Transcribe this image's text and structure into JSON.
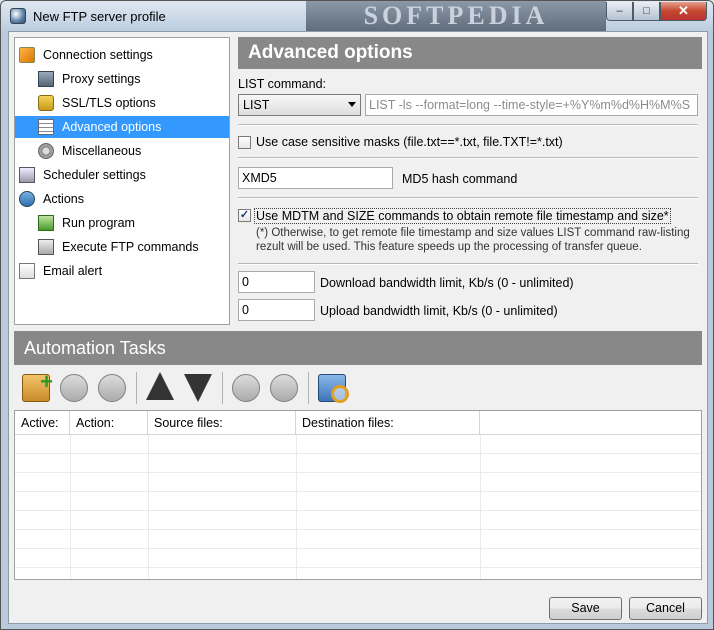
{
  "window": {
    "title": "New FTP server profile",
    "watermark": "SOFTPEDIA",
    "controls": {
      "minimize": "–",
      "maximize": "□",
      "close": "✕"
    }
  },
  "tree": {
    "items": [
      {
        "label": "Connection settings",
        "icon": "connection-icon",
        "level": 0
      },
      {
        "label": "Proxy settings",
        "icon": "proxy-icon",
        "level": 1
      },
      {
        "label": "SSL/TLS options",
        "icon": "lock-icon",
        "level": 1
      },
      {
        "label": "Advanced options",
        "icon": "advanced-icon",
        "level": 1,
        "selected": true
      },
      {
        "label": "Miscellaneous",
        "icon": "misc-icon",
        "level": 1
      },
      {
        "label": "Scheduler settings",
        "icon": "scheduler-icon",
        "level": 0
      },
      {
        "label": "Actions",
        "icon": "actions-icon",
        "level": 0
      },
      {
        "label": "Run program",
        "icon": "run-icon",
        "level": 1
      },
      {
        "label": "Execute FTP commands",
        "icon": "execute-icon",
        "level": 1
      },
      {
        "label": "Email alert",
        "icon": "email-icon",
        "level": 0
      }
    ]
  },
  "advanced": {
    "header": "Advanced options",
    "list_command_label": "LIST command:",
    "list_command_value": "LIST",
    "list_command_text": "LIST -ls --format=long --time-style=+%Y%m%d%H%M%S",
    "case_sensitive_label": "Use case sensitive masks (file.txt==*.txt, file.TXT!=*.txt)",
    "case_sensitive_checked": false,
    "md5_value": "XMD5",
    "md5_label": "MD5 hash command",
    "mdtm_label": "Use MDTM and SIZE commands to obtain remote file timestamp and size*",
    "mdtm_checked": true,
    "mdtm_note": "(*) Otherwise, to get remote file timestamp and size values LIST command raw-listing rezult will be used. This feature speeds up the processing of transfer queue.",
    "download_value": "0",
    "download_label": "Download bandwidth limit, Kb/s (0 - unlimited)",
    "upload_value": "0",
    "upload_label": "Upload bandwidth limit, Kb/s (0 - unlimited)"
  },
  "automation": {
    "header": "Automation Tasks",
    "toolbar": [
      "add-task-icon",
      "edit-task-icon",
      "delete-task-icon",
      "move-up-icon",
      "move-down-icon",
      "run-task-icon",
      "stop-task-icon",
      "browse-icon"
    ],
    "columns": [
      "Active:",
      "Action:",
      "Source files:",
      "Destination files:"
    ],
    "rows": []
  },
  "buttons": {
    "save": "Save",
    "cancel": "Cancel"
  },
  "colors": {
    "header_bg": "#888888",
    "selection": "#3399ff"
  }
}
